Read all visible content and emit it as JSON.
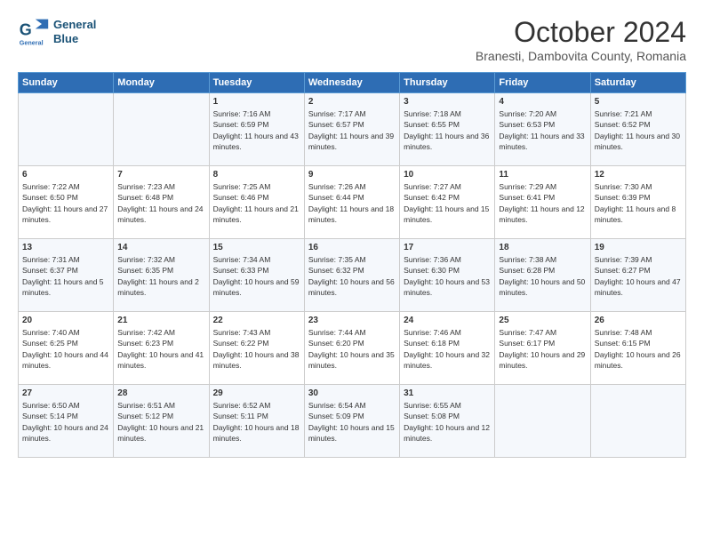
{
  "header": {
    "logo_line1": "General",
    "logo_line2": "Blue",
    "month": "October 2024",
    "location": "Branesti, Dambovita County, Romania"
  },
  "weekdays": [
    "Sunday",
    "Monday",
    "Tuesday",
    "Wednesday",
    "Thursday",
    "Friday",
    "Saturday"
  ],
  "weeks": [
    [
      {
        "day": "",
        "info": ""
      },
      {
        "day": "",
        "info": ""
      },
      {
        "day": "1",
        "info": "Sunrise: 7:16 AM\nSunset: 6:59 PM\nDaylight: 11 hours and 43 minutes."
      },
      {
        "day": "2",
        "info": "Sunrise: 7:17 AM\nSunset: 6:57 PM\nDaylight: 11 hours and 39 minutes."
      },
      {
        "day": "3",
        "info": "Sunrise: 7:18 AM\nSunset: 6:55 PM\nDaylight: 11 hours and 36 minutes."
      },
      {
        "day": "4",
        "info": "Sunrise: 7:20 AM\nSunset: 6:53 PM\nDaylight: 11 hours and 33 minutes."
      },
      {
        "day": "5",
        "info": "Sunrise: 7:21 AM\nSunset: 6:52 PM\nDaylight: 11 hours and 30 minutes."
      }
    ],
    [
      {
        "day": "6",
        "info": "Sunrise: 7:22 AM\nSunset: 6:50 PM\nDaylight: 11 hours and 27 minutes."
      },
      {
        "day": "7",
        "info": "Sunrise: 7:23 AM\nSunset: 6:48 PM\nDaylight: 11 hours and 24 minutes."
      },
      {
        "day": "8",
        "info": "Sunrise: 7:25 AM\nSunset: 6:46 PM\nDaylight: 11 hours and 21 minutes."
      },
      {
        "day": "9",
        "info": "Sunrise: 7:26 AM\nSunset: 6:44 PM\nDaylight: 11 hours and 18 minutes."
      },
      {
        "day": "10",
        "info": "Sunrise: 7:27 AM\nSunset: 6:42 PM\nDaylight: 11 hours and 15 minutes."
      },
      {
        "day": "11",
        "info": "Sunrise: 7:29 AM\nSunset: 6:41 PM\nDaylight: 11 hours and 12 minutes."
      },
      {
        "day": "12",
        "info": "Sunrise: 7:30 AM\nSunset: 6:39 PM\nDaylight: 11 hours and 8 minutes."
      }
    ],
    [
      {
        "day": "13",
        "info": "Sunrise: 7:31 AM\nSunset: 6:37 PM\nDaylight: 11 hours and 5 minutes."
      },
      {
        "day": "14",
        "info": "Sunrise: 7:32 AM\nSunset: 6:35 PM\nDaylight: 11 hours and 2 minutes."
      },
      {
        "day": "15",
        "info": "Sunrise: 7:34 AM\nSunset: 6:33 PM\nDaylight: 10 hours and 59 minutes."
      },
      {
        "day": "16",
        "info": "Sunrise: 7:35 AM\nSunset: 6:32 PM\nDaylight: 10 hours and 56 minutes."
      },
      {
        "day": "17",
        "info": "Sunrise: 7:36 AM\nSunset: 6:30 PM\nDaylight: 10 hours and 53 minutes."
      },
      {
        "day": "18",
        "info": "Sunrise: 7:38 AM\nSunset: 6:28 PM\nDaylight: 10 hours and 50 minutes."
      },
      {
        "day": "19",
        "info": "Sunrise: 7:39 AM\nSunset: 6:27 PM\nDaylight: 10 hours and 47 minutes."
      }
    ],
    [
      {
        "day": "20",
        "info": "Sunrise: 7:40 AM\nSunset: 6:25 PM\nDaylight: 10 hours and 44 minutes."
      },
      {
        "day": "21",
        "info": "Sunrise: 7:42 AM\nSunset: 6:23 PM\nDaylight: 10 hours and 41 minutes."
      },
      {
        "day": "22",
        "info": "Sunrise: 7:43 AM\nSunset: 6:22 PM\nDaylight: 10 hours and 38 minutes."
      },
      {
        "day": "23",
        "info": "Sunrise: 7:44 AM\nSunset: 6:20 PM\nDaylight: 10 hours and 35 minutes."
      },
      {
        "day": "24",
        "info": "Sunrise: 7:46 AM\nSunset: 6:18 PM\nDaylight: 10 hours and 32 minutes."
      },
      {
        "day": "25",
        "info": "Sunrise: 7:47 AM\nSunset: 6:17 PM\nDaylight: 10 hours and 29 minutes."
      },
      {
        "day": "26",
        "info": "Sunrise: 7:48 AM\nSunset: 6:15 PM\nDaylight: 10 hours and 26 minutes."
      }
    ],
    [
      {
        "day": "27",
        "info": "Sunrise: 6:50 AM\nSunset: 5:14 PM\nDaylight: 10 hours and 24 minutes."
      },
      {
        "day": "28",
        "info": "Sunrise: 6:51 AM\nSunset: 5:12 PM\nDaylight: 10 hours and 21 minutes."
      },
      {
        "day": "29",
        "info": "Sunrise: 6:52 AM\nSunset: 5:11 PM\nDaylight: 10 hours and 18 minutes."
      },
      {
        "day": "30",
        "info": "Sunrise: 6:54 AM\nSunset: 5:09 PM\nDaylight: 10 hours and 15 minutes."
      },
      {
        "day": "31",
        "info": "Sunrise: 6:55 AM\nSunset: 5:08 PM\nDaylight: 10 hours and 12 minutes."
      },
      {
        "day": "",
        "info": ""
      },
      {
        "day": "",
        "info": ""
      }
    ]
  ]
}
